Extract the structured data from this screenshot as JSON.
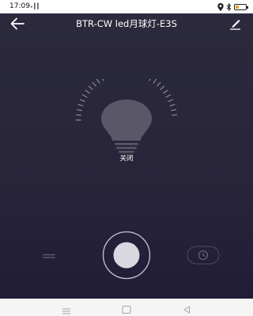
{
  "status_bar": {
    "time": "17:09",
    "signal_text": "₊┃┃",
    "battery_level": 0.35,
    "battery_color": "#e2a91a",
    "icons": [
      "location-icon",
      "bluetooth-icon",
      "battery-icon"
    ]
  },
  "header": {
    "title": "BTR-CW led月球灯-E3S",
    "back_icon": "arrow-left-icon",
    "edit_icon": "edit-pencil-icon"
  },
  "device": {
    "status": "关闭",
    "bulb_icon": "light-bulb-icon"
  },
  "controls": {
    "left_icon": "menu-lines-icon",
    "power_icon": "power-toggle-icon",
    "timer_icon": "clock-icon"
  },
  "nav_bar": {
    "icons": [
      "menu-icon",
      "home-icon",
      "back-triangle-icon"
    ]
  },
  "colors": {
    "background_top": "#2c2a3d",
    "background_bottom": "#211b36",
    "text": "#ffffff",
    "bulb_off": "#5a5868"
  }
}
